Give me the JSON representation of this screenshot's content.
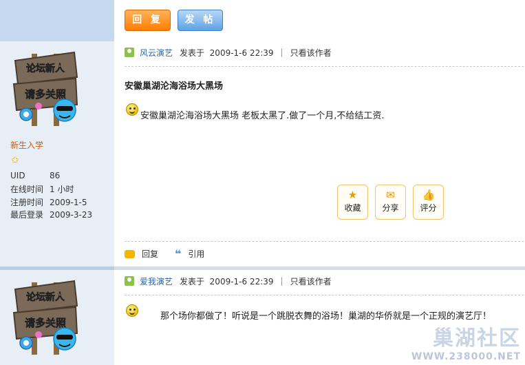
{
  "toolbar": {
    "reply_label": "回 复",
    "post_label": "发 帖"
  },
  "posts": [
    {
      "avatar_text": [
        "论坛新人",
        "请多关照"
      ],
      "rank": "新生入学",
      "stats": [
        {
          "k": "UID",
          "v": "86"
        },
        {
          "k": "在线时间",
          "v": "1 小时"
        },
        {
          "k": "注册时间",
          "v": "2009-1-5"
        },
        {
          "k": "最后登录",
          "v": "2009-3-23"
        }
      ],
      "author": "风云演艺",
      "posted_label": "发表于",
      "posted_time": "2009-1-6 22:39",
      "only_author": "只看该作者",
      "title": "安徽巢湖沦海浴场大黑场",
      "body": "安徽巢湖沦海浴场大黑场  老板太黑了.做了一个月,不给结工资.",
      "actions": [
        "收藏",
        "分享",
        "评分"
      ],
      "reply": "回复",
      "quote": "引用"
    },
    {
      "avatar_text": [
        "论坛新人",
        "请多关照"
      ],
      "author": "爱我演艺",
      "posted_label": "发表于",
      "posted_time": "2009-1-6 22:39",
      "only_author": "只看该作者",
      "body": "那个场你都做了！听说是一个跳脱衣舞的浴场！巢湖的华侨就是一个正规的演艺厅！"
    }
  ],
  "watermark": {
    "name": "巢湖社区",
    "url": "WWW.238000.NET"
  },
  "icons": [
    "user-icon",
    "smiley-icon",
    "star-icon",
    "envelope-icon",
    "thumb-icon",
    "reply-icon",
    "quote-icon"
  ]
}
